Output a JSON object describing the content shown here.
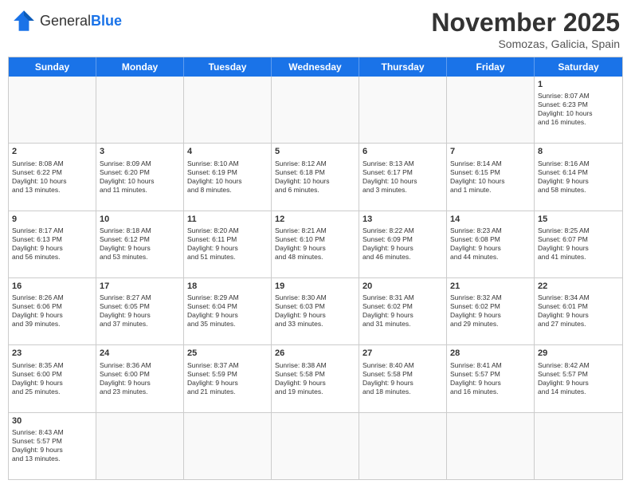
{
  "header": {
    "logo_general": "General",
    "logo_blue": "Blue",
    "month": "November 2025",
    "location": "Somozas, Galicia, Spain"
  },
  "days": [
    "Sunday",
    "Monday",
    "Tuesday",
    "Wednesday",
    "Thursday",
    "Friday",
    "Saturday"
  ],
  "rows": [
    [
      {
        "day": "",
        "empty": true
      },
      {
        "day": "",
        "empty": true
      },
      {
        "day": "",
        "empty": true
      },
      {
        "day": "",
        "empty": true
      },
      {
        "day": "",
        "empty": true
      },
      {
        "day": "",
        "empty": true
      },
      {
        "day": "1",
        "info": "Sunrise: 8:07 AM\nSunset: 6:23 PM\nDaylight: 10 hours\nand 16 minutes."
      }
    ],
    [
      {
        "day": "2",
        "info": "Sunrise: 8:08 AM\nSunset: 6:22 PM\nDaylight: 10 hours\nand 13 minutes."
      },
      {
        "day": "3",
        "info": "Sunrise: 8:09 AM\nSunset: 6:20 PM\nDaylight: 10 hours\nand 11 minutes."
      },
      {
        "day": "4",
        "info": "Sunrise: 8:10 AM\nSunset: 6:19 PM\nDaylight: 10 hours\nand 8 minutes."
      },
      {
        "day": "5",
        "info": "Sunrise: 8:12 AM\nSunset: 6:18 PM\nDaylight: 10 hours\nand 6 minutes."
      },
      {
        "day": "6",
        "info": "Sunrise: 8:13 AM\nSunset: 6:17 PM\nDaylight: 10 hours\nand 3 minutes."
      },
      {
        "day": "7",
        "info": "Sunrise: 8:14 AM\nSunset: 6:15 PM\nDaylight: 10 hours\nand 1 minute."
      },
      {
        "day": "8",
        "info": "Sunrise: 8:16 AM\nSunset: 6:14 PM\nDaylight: 9 hours\nand 58 minutes."
      }
    ],
    [
      {
        "day": "9",
        "info": "Sunrise: 8:17 AM\nSunset: 6:13 PM\nDaylight: 9 hours\nand 56 minutes."
      },
      {
        "day": "10",
        "info": "Sunrise: 8:18 AM\nSunset: 6:12 PM\nDaylight: 9 hours\nand 53 minutes."
      },
      {
        "day": "11",
        "info": "Sunrise: 8:20 AM\nSunset: 6:11 PM\nDaylight: 9 hours\nand 51 minutes."
      },
      {
        "day": "12",
        "info": "Sunrise: 8:21 AM\nSunset: 6:10 PM\nDaylight: 9 hours\nand 48 minutes."
      },
      {
        "day": "13",
        "info": "Sunrise: 8:22 AM\nSunset: 6:09 PM\nDaylight: 9 hours\nand 46 minutes."
      },
      {
        "day": "14",
        "info": "Sunrise: 8:23 AM\nSunset: 6:08 PM\nDaylight: 9 hours\nand 44 minutes."
      },
      {
        "day": "15",
        "info": "Sunrise: 8:25 AM\nSunset: 6:07 PM\nDaylight: 9 hours\nand 41 minutes."
      }
    ],
    [
      {
        "day": "16",
        "info": "Sunrise: 8:26 AM\nSunset: 6:06 PM\nDaylight: 9 hours\nand 39 minutes."
      },
      {
        "day": "17",
        "info": "Sunrise: 8:27 AM\nSunset: 6:05 PM\nDaylight: 9 hours\nand 37 minutes."
      },
      {
        "day": "18",
        "info": "Sunrise: 8:29 AM\nSunset: 6:04 PM\nDaylight: 9 hours\nand 35 minutes."
      },
      {
        "day": "19",
        "info": "Sunrise: 8:30 AM\nSunset: 6:03 PM\nDaylight: 9 hours\nand 33 minutes."
      },
      {
        "day": "20",
        "info": "Sunrise: 8:31 AM\nSunset: 6:02 PM\nDaylight: 9 hours\nand 31 minutes."
      },
      {
        "day": "21",
        "info": "Sunrise: 8:32 AM\nSunset: 6:02 PM\nDaylight: 9 hours\nand 29 minutes."
      },
      {
        "day": "22",
        "info": "Sunrise: 8:34 AM\nSunset: 6:01 PM\nDaylight: 9 hours\nand 27 minutes."
      }
    ],
    [
      {
        "day": "23",
        "info": "Sunrise: 8:35 AM\nSunset: 6:00 PM\nDaylight: 9 hours\nand 25 minutes."
      },
      {
        "day": "24",
        "info": "Sunrise: 8:36 AM\nSunset: 6:00 PM\nDaylight: 9 hours\nand 23 minutes."
      },
      {
        "day": "25",
        "info": "Sunrise: 8:37 AM\nSunset: 5:59 PM\nDaylight: 9 hours\nand 21 minutes."
      },
      {
        "day": "26",
        "info": "Sunrise: 8:38 AM\nSunset: 5:58 PM\nDaylight: 9 hours\nand 19 minutes."
      },
      {
        "day": "27",
        "info": "Sunrise: 8:40 AM\nSunset: 5:58 PM\nDaylight: 9 hours\nand 18 minutes."
      },
      {
        "day": "28",
        "info": "Sunrise: 8:41 AM\nSunset: 5:57 PM\nDaylight: 9 hours\nand 16 minutes."
      },
      {
        "day": "29",
        "info": "Sunrise: 8:42 AM\nSunset: 5:57 PM\nDaylight: 9 hours\nand 14 minutes."
      }
    ],
    [
      {
        "day": "30",
        "info": "Sunrise: 8:43 AM\nSunset: 5:57 PM\nDaylight: 9 hours\nand 13 minutes."
      },
      {
        "day": "",
        "empty": true
      },
      {
        "day": "",
        "empty": true
      },
      {
        "day": "",
        "empty": true
      },
      {
        "day": "",
        "empty": true
      },
      {
        "day": "",
        "empty": true
      },
      {
        "day": "",
        "empty": true
      }
    ]
  ]
}
